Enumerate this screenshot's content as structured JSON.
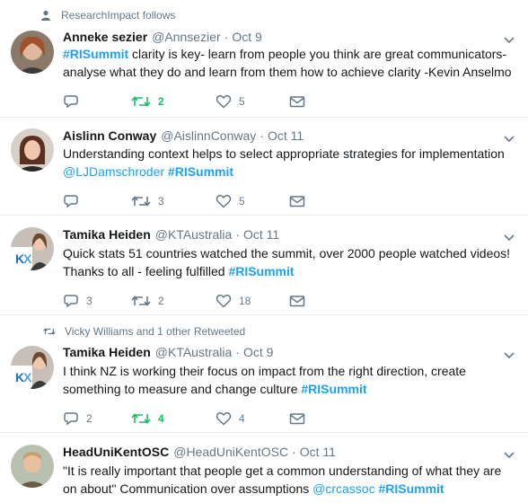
{
  "tweets": [
    {
      "context": "ResearchImpact follows",
      "name": "Anneke sezier",
      "handle": "@Annsezier",
      "dot": "·",
      "time": "Oct 9",
      "text_parts": {
        "tag1": "#RISummit",
        "rest": " clarity is key- learn from people you think are great communicators- analyse what they do and learn from them how to achieve clarity -Kevin Anselmo"
      },
      "reply_count": "",
      "retweet_count": "2",
      "like_count": "5",
      "retweeted": true
    },
    {
      "name": "Aislinn Conway",
      "handle": "@AislinnConway",
      "dot": "·",
      "time": "Oct 11",
      "text_parts": {
        "line1": "Understanding context helps to select appropriate strategies for implementation",
        "mention": "@LJDamschroder",
        "sp": " ",
        "tag1": "#RISummit"
      },
      "reply_count": "",
      "retweet_count": "3",
      "like_count": "5",
      "retweeted": false
    },
    {
      "name": "Tamika Heiden",
      "handle": "@KTAustralia",
      "dot": "·",
      "time": "Oct 11",
      "text_parts": {
        "line1": "Quick stats 51 countries watched the summit, over 2000 people watched videos!",
        "line2": "Thanks to all - feeling fulfilled ",
        "tag1": "#RISummit"
      },
      "reply_count": "3",
      "retweet_count": "2",
      "like_count": "18",
      "retweeted": false
    },
    {
      "context": "Vicky Williams and 1 other Retweeted",
      "name": "Tamika Heiden",
      "handle": "@KTAustralia",
      "dot": "·",
      "time": "Oct 9",
      "text_parts": {
        "line1": "I think NZ is working their focus on impact from the right direction, create",
        "line2": "something to measure and change culture ",
        "tag1": "#RISummit"
      },
      "reply_count": "2",
      "retweet_count": "4",
      "like_count": "4",
      "retweeted": true
    },
    {
      "name": "HeadUniKentOSC",
      "handle": "@HeadUniKentOSC",
      "dot": "·",
      "time": "Oct 11",
      "text_parts": {
        "line1": "\"It is really important that people get a common understanding of what they are",
        "line2": "on about\" Communication over assumptions ",
        "mention": "@crcassoc",
        "sp": " ",
        "tag1": "#RISummit"
      }
    }
  ],
  "colors": {
    "link": "#1da1f2",
    "retweet_active": "#17bf63",
    "muted": "#657786",
    "divider": "#e6ecf0"
  },
  "icons": [
    "person-icon",
    "retweet-icon",
    "reply-icon",
    "like-icon",
    "dm-icon",
    "chevron-down-icon"
  ]
}
